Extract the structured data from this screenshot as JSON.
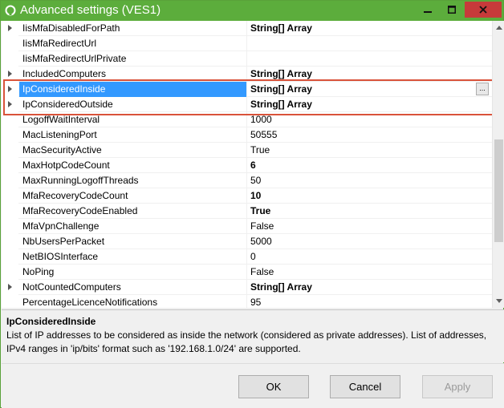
{
  "window": {
    "title": "Advanced settings (VES1)",
    "accent_color": "#5cad3c",
    "close_color": "#c73a3a"
  },
  "grid": {
    "rows": [
      {
        "name": "IisMfaDisabledForPath",
        "value": "String[] Array",
        "bold": true,
        "expandable": true
      },
      {
        "name": "IisMfaRedirectUrl",
        "value": "",
        "bold": false,
        "expandable": false
      },
      {
        "name": "IisMfaRedirectUrlPrivate",
        "value": "",
        "bold": false,
        "expandable": false
      },
      {
        "name": "IncludedComputers",
        "value": "String[] Array",
        "bold": true,
        "expandable": true
      },
      {
        "name": "IpConsideredInside",
        "value": "String[] Array",
        "bold": true,
        "expandable": true,
        "selected": true
      },
      {
        "name": "IpConsideredOutside",
        "value": "String[] Array",
        "bold": true,
        "expandable": true
      },
      {
        "name": "LogoffWaitInterval",
        "value": "1000",
        "bold": false,
        "expandable": false
      },
      {
        "name": "MacListeningPort",
        "value": "50555",
        "bold": false,
        "expandable": false
      },
      {
        "name": "MacSecurityActive",
        "value": "True",
        "bold": false,
        "expandable": false
      },
      {
        "name": "MaxHotpCodeCount",
        "value": "6",
        "bold": true,
        "expandable": false
      },
      {
        "name": "MaxRunningLogoffThreads",
        "value": "50",
        "bold": false,
        "expandable": false
      },
      {
        "name": "MfaRecoveryCodeCount",
        "value": "10",
        "bold": true,
        "expandable": false
      },
      {
        "name": "MfaRecoveryCodeEnabled",
        "value": "True",
        "bold": true,
        "expandable": false
      },
      {
        "name": "MfaVpnChallenge",
        "value": "False",
        "bold": false,
        "expandable": false
      },
      {
        "name": "NbUsersPerPacket",
        "value": "5000",
        "bold": false,
        "expandable": false
      },
      {
        "name": "NetBIOSInterface",
        "value": "0",
        "bold": false,
        "expandable": false
      },
      {
        "name": "NoPing",
        "value": "False",
        "bold": false,
        "expandable": false
      },
      {
        "name": "NotCountedComputers",
        "value": "String[] Array",
        "bold": true,
        "expandable": true
      },
      {
        "name": "PercentageLicenceNotifications",
        "value": "95",
        "bold": false,
        "expandable": false
      }
    ],
    "ellipsis_label": "...",
    "selected_color": "#3399ff",
    "highlight_color": "#d9533a"
  },
  "description": {
    "title": "IpConsideredInside",
    "text": "List of IP addresses to be considered as inside the network (considered as private addresses). List of addresses, IPv4 ranges in 'ip/bits' format such as '192.168.1.0/24' are supported."
  },
  "buttons": {
    "ok": "OK",
    "cancel": "Cancel",
    "apply": "Apply"
  },
  "icons": {
    "app": "app-logo-icon",
    "minimize": "minimize-icon",
    "maximize": "maximize-icon",
    "close": "close-icon",
    "expand": "expand-arrow-icon",
    "scroll_up": "scroll-up-icon",
    "scroll_down": "scroll-down-icon"
  }
}
